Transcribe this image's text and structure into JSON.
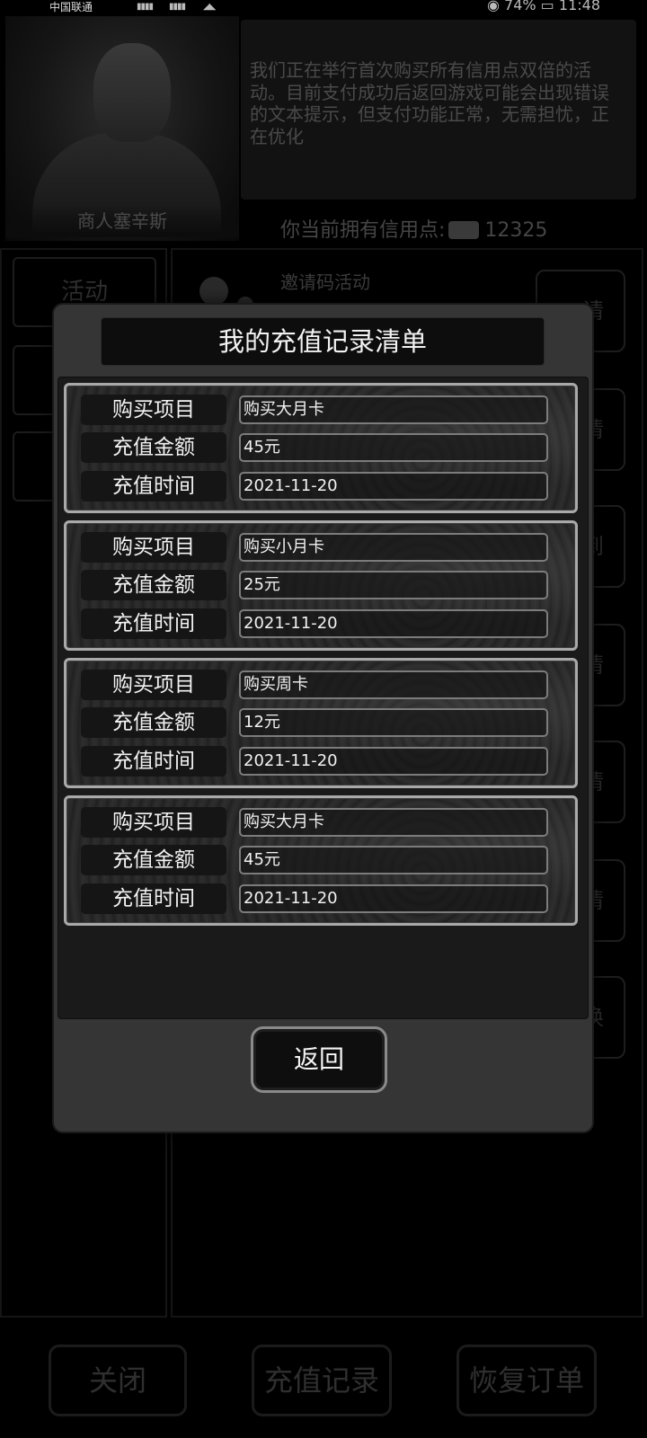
{
  "status_bar": {
    "carrier": "中国联通",
    "battery": "74%",
    "time": "11:48"
  },
  "background": {
    "merchant_name": "商人塞辛斯",
    "notice": "我们正在举行首次购买所有信用点双倍的活动。目前支付成功后返回游戏可能会出现错误的文本提示，但支付功能正常，无需担忧，正在优化",
    "credits_label": "你当前拥有信用点:",
    "credits_value": "12325",
    "left_tabs": [
      "活动",
      "",
      ""
    ],
    "invite_title": "邀请码活动",
    "side_buttons": [
      "请",
      "请",
      "到",
      "请",
      "请",
      "请",
      "换"
    ],
    "bottom_buttons": [
      "关闭",
      "充值记录",
      "恢复订单"
    ]
  },
  "dialog": {
    "title": "我的充值记录清单",
    "back_button": "返回",
    "records": [
      {
        "item_label": "购买项目",
        "item": "购买大月卡",
        "amount_label": "充值金额",
        "amount": "45元",
        "time_label": "充值时间",
        "time": "2021-11-20"
      },
      {
        "item_label": "购买项目",
        "item": "购买小月卡",
        "amount_label": "充值金额",
        "amount": "25元",
        "time_label": "充值时间",
        "time": "2021-11-20"
      },
      {
        "item_label": "购买项目",
        "item": "购买周卡",
        "amount_label": "充值金额",
        "amount": "12元",
        "time_label": "充值时间",
        "time": "2021-11-20"
      },
      {
        "item_label": "购买项目",
        "item": "购买大月卡",
        "amount_label": "充值金额",
        "amount": "45元",
        "time_label": "充值时间",
        "time": "2021-11-20"
      }
    ]
  }
}
